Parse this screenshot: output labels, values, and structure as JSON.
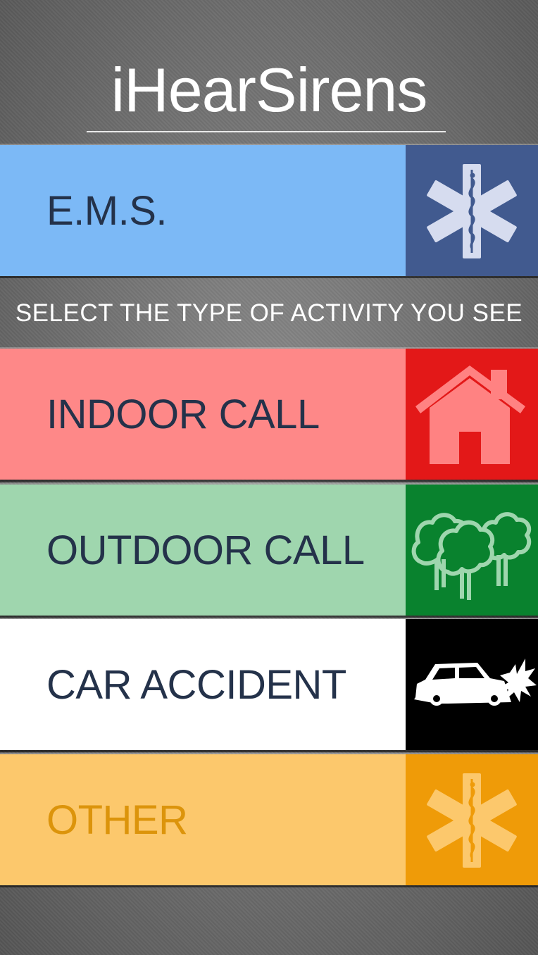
{
  "app": {
    "title": "iHearSirens"
  },
  "ems": {
    "label": "E.M.S.",
    "icon": "star-of-life-icon"
  },
  "prompt": "SELECT THE TYPE OF ACTIVITY YOU SEE",
  "activities": [
    {
      "label": "INDOOR CALL",
      "icon": "house-icon"
    },
    {
      "label": "OUTDOOR CALL",
      "icon": "trees-icon"
    },
    {
      "label": "CAR ACCIDENT",
      "icon": "car-crash-icon"
    },
    {
      "label": "OTHER",
      "icon": "star-of-life-icon"
    }
  ],
  "colors": {
    "ems": "#7cb9f6",
    "ems_tile": "#415a8f",
    "indoor": "#fe8888",
    "indoor_tile": "#e31818",
    "outdoor": "#9fd6ae",
    "outdoor_tile": "#09822e",
    "accident": "#ffffff",
    "accident_tile": "#000000",
    "other": "#fcc86c",
    "other_tile": "#ef9b08",
    "label_text": "#24324a",
    "other_text": "#dc940b"
  }
}
